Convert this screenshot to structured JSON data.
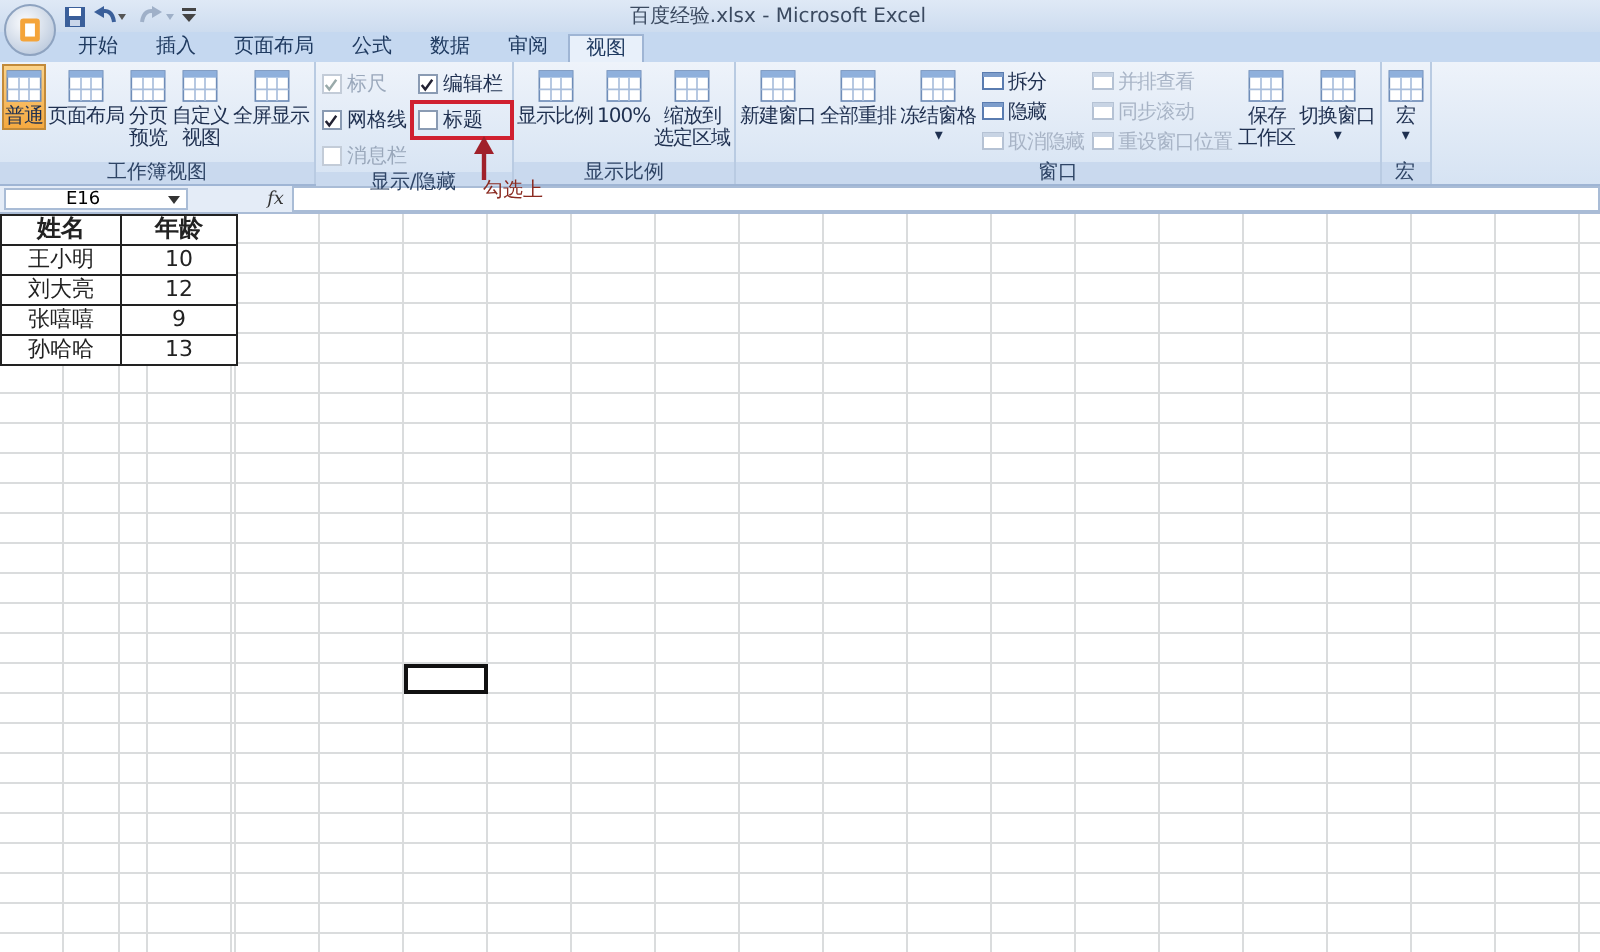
{
  "window": {
    "title": "百度经验.xlsx - Microsoft Excel"
  },
  "tabs": [
    {
      "label": "开始",
      "selected": false
    },
    {
      "label": "插入",
      "selected": false
    },
    {
      "label": "页面布局",
      "selected": false
    },
    {
      "label": "公式",
      "selected": false
    },
    {
      "label": "数据",
      "selected": false
    },
    {
      "label": "审阅",
      "selected": false
    },
    {
      "label": "视图",
      "selected": true
    }
  ],
  "ribbon": {
    "groups": [
      {
        "label": "工作簿视图",
        "items": [
          {
            "kind": "large",
            "lines": [
              "普通"
            ],
            "selected": true
          },
          {
            "kind": "large",
            "lines": [
              "页面布局"
            ],
            "selected": false
          },
          {
            "kind": "large",
            "lines": [
              "分页",
              "预览"
            ],
            "selected": false
          },
          {
            "kind": "large",
            "lines": [
              "自定义",
              "视图"
            ],
            "selected": false
          },
          {
            "kind": "large",
            "lines": [
              "全屏显示"
            ],
            "selected": false
          }
        ]
      },
      {
        "label": "显示/隐藏",
        "items": [
          {
            "kind": "checks",
            "items": [
              {
                "label": "标尺",
                "checked": true,
                "disabled": true,
                "highlighted": false
              },
              {
                "label": "网格线",
                "checked": true,
                "disabled": false,
                "highlighted": false
              },
              {
                "label": "消息栏",
                "checked": false,
                "disabled": true,
                "highlighted": false
              }
            ]
          },
          {
            "kind": "checks",
            "items": [
              {
                "label": "编辑栏",
                "checked": true,
                "disabled": false,
                "highlighted": false
              },
              {
                "label": "标题",
                "checked": false,
                "disabled": false,
                "highlighted": true,
                "annotation": "勾选上"
              }
            ]
          }
        ]
      },
      {
        "label": "显示比例",
        "items": [
          {
            "kind": "large",
            "lines": [
              "显示比例"
            ],
            "selected": false
          },
          {
            "kind": "large",
            "lines": [
              "100%"
            ],
            "selected": false
          },
          {
            "kind": "large",
            "lines": [
              "缩放到",
              "选定区域"
            ],
            "selected": false
          }
        ]
      },
      {
        "label": "窗口",
        "items": [
          {
            "kind": "large",
            "lines": [
              "新建窗口"
            ],
            "selected": false
          },
          {
            "kind": "large",
            "lines": [
              "全部重排"
            ],
            "selected": false
          },
          {
            "kind": "large",
            "lines": [
              "冻结窗格"
            ],
            "selected": false,
            "dropdown": "▾"
          },
          {
            "kind": "smalls",
            "items": [
              {
                "label": "拆分",
                "disabled": false
              },
              {
                "label": "隐藏",
                "disabled": false
              },
              {
                "label": "取消隐藏",
                "disabled": true
              }
            ]
          },
          {
            "kind": "smalls",
            "items": [
              {
                "label": "并排查看",
                "disabled": true
              },
              {
                "label": "同步滚动",
                "disabled": true
              },
              {
                "label": "重设窗口位置",
                "disabled": true
              }
            ]
          },
          {
            "kind": "large",
            "lines": [
              "保存",
              "工作区"
            ],
            "selected": false
          },
          {
            "kind": "large",
            "lines": [
              "切换窗口"
            ],
            "selected": false,
            "dropdown": "▾"
          }
        ]
      },
      {
        "label": "宏",
        "items": [
          {
            "kind": "large",
            "lines": [
              "宏"
            ],
            "selected": false,
            "dropdown": "▾"
          }
        ]
      }
    ]
  },
  "formula_bar": {
    "name_box": "E16",
    "function_label": "fx"
  },
  "table": {
    "columns": [
      "姓名",
      "年龄"
    ],
    "rows": [
      [
        "王小明",
        "10"
      ],
      [
        "刘大亮",
        "12"
      ],
      [
        "张嘻嘻",
        "9"
      ],
      [
        "孙哈哈",
        "13"
      ]
    ]
  }
}
